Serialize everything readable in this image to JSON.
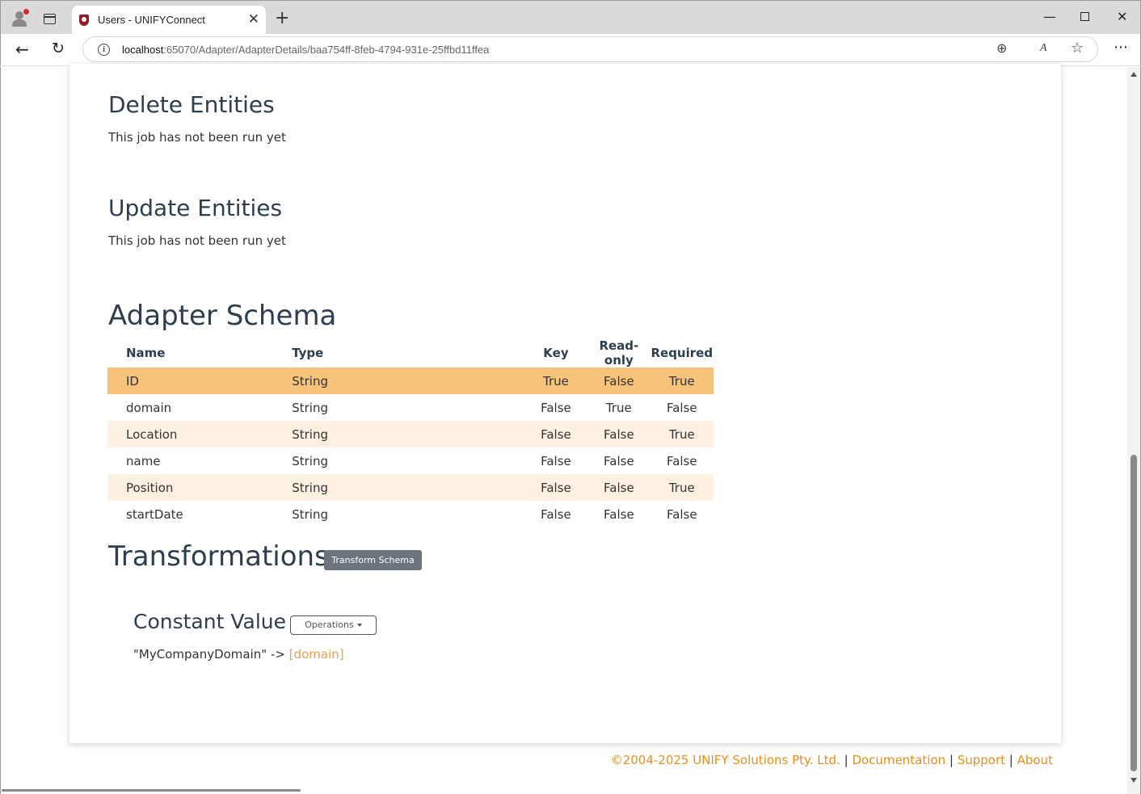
{
  "browser": {
    "tab_title": "Users - UNIFYConnect",
    "tab_close": "✕",
    "new_tab": "+",
    "url_host": "localhost",
    "url_path": ":65070/Adapter/AdapterDetails/baa754ff-8feb-4794-931e-25ffbd11ffea",
    "back": "←",
    "reload": "↻",
    "info": "i",
    "zoom": "⊕",
    "read_aloud": "A",
    "favorite": "☆",
    "menu": "⋯",
    "minimize": "—",
    "close": "✕"
  },
  "sections": {
    "delete": {
      "title": "Delete Entities",
      "status": "This job has not been run yet"
    },
    "update": {
      "title": "Update Entities",
      "status": "This job has not been run yet"
    }
  },
  "schema": {
    "title": "Adapter Schema",
    "headers": {
      "name": "Name",
      "type": "Type",
      "key": "Key",
      "readonly": "Read-only",
      "required": "Required"
    },
    "rows": [
      {
        "name": "ID",
        "type": "String",
        "key": "True",
        "readonly": "False",
        "required": "True"
      },
      {
        "name": "domain",
        "type": "String",
        "key": "False",
        "readonly": "True",
        "required": "False"
      },
      {
        "name": "Location",
        "type": "String",
        "key": "False",
        "readonly": "False",
        "required": "True"
      },
      {
        "name": "name",
        "type": "String",
        "key": "False",
        "readonly": "False",
        "required": "False"
      },
      {
        "name": "Position",
        "type": "String",
        "key": "False",
        "readonly": "False",
        "required": "True"
      },
      {
        "name": "startDate",
        "type": "String",
        "key": "False",
        "readonly": "False",
        "required": "False"
      }
    ]
  },
  "transformations": {
    "title": "Transformations",
    "transform_button": "Transform Schema",
    "item": {
      "title": "Constant Value",
      "operations_button": "Operations",
      "source": "\"MyCompanyDomain\" ->",
      "target": "[domain]"
    }
  },
  "footer": {
    "copyright": "©2004-2025 UNIFY Solutions Pty. Ltd.",
    "sep": "|",
    "documentation": "Documentation",
    "support": "Support",
    "about": "About"
  },
  "colors": {
    "accent": "#e88e1c",
    "row_active": "#f7c27a",
    "row_stripe": "#fef1e3",
    "secondary_button": "#6c757d"
  }
}
